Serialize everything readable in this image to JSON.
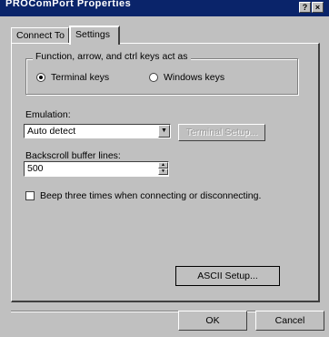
{
  "window": {
    "title": "PROComPort Properties"
  },
  "titlebar_buttons": {
    "help_label": "?",
    "close_label": "×"
  },
  "tabs": [
    {
      "label": "Connect To"
    },
    {
      "label": "Settings"
    }
  ],
  "group": {
    "label": "Function, arrow, and ctrl keys act as"
  },
  "radios": [
    {
      "label": "Terminal keys",
      "selected": true
    },
    {
      "label": "Windows keys",
      "selected": false
    }
  ],
  "emulation": {
    "label": "Emulation:",
    "value": "Auto detect",
    "terminal_setup_label": "Terminal Setup..."
  },
  "backscroll": {
    "label": "Backscroll buffer lines:",
    "value": "500"
  },
  "beep": {
    "label": "Beep three times when connecting or disconnecting.",
    "checked": false
  },
  "ascii_setup_label": "ASCII Setup...",
  "footer": {
    "ok_label": "OK",
    "cancel_label": "Cancel"
  }
}
